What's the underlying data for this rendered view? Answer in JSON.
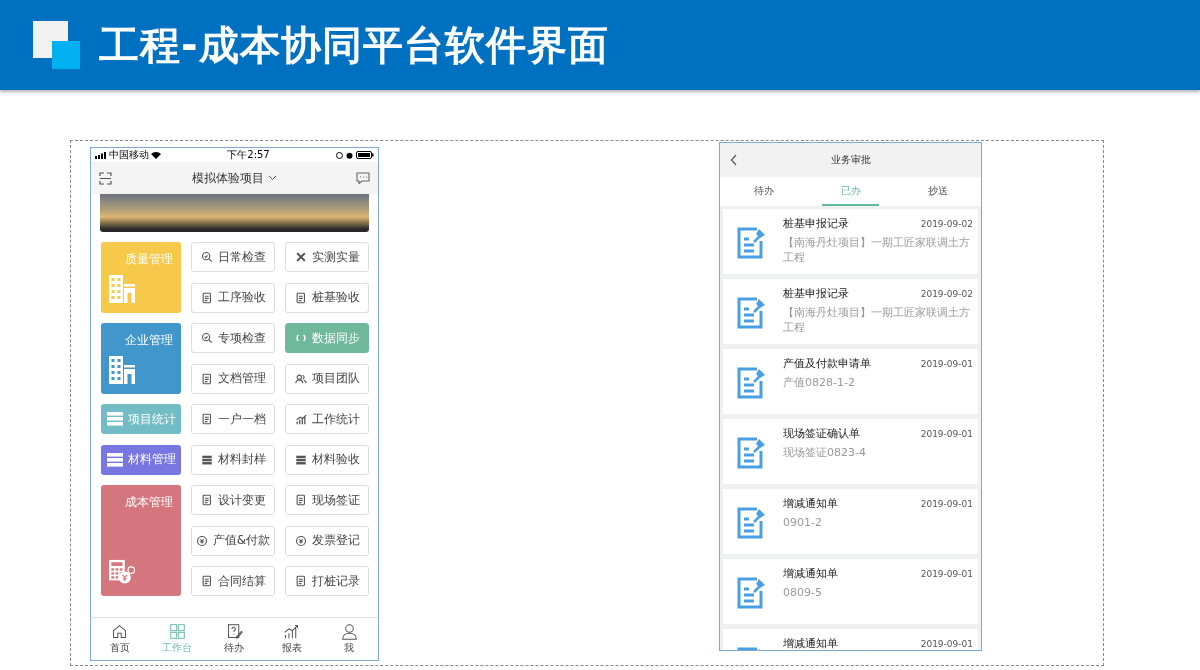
{
  "header": {
    "title": "工程-成本协同平台软件界面"
  },
  "phone_left": {
    "status_bar": {
      "carrier": "中国移动",
      "time": "下午2:57"
    },
    "nav": {
      "title": "模拟体验项目"
    },
    "groups": [
      {
        "label": "质量管理",
        "color": "#f6c94a",
        "kind": "building",
        "actions": [
          {
            "label": "日常检查",
            "active": false
          },
          {
            "label": "实测实量",
            "active": false
          },
          {
            "label": "工序验收",
            "active": false
          },
          {
            "label": "桩基验收",
            "active": false
          }
        ]
      },
      {
        "label": "企业管理",
        "color": "#4196cb",
        "kind": "building",
        "actions": [
          {
            "label": "专项检查",
            "active": false
          },
          {
            "label": "数据同步",
            "active": true
          },
          {
            "label": "文档管理",
            "active": false
          },
          {
            "label": "项目团队",
            "active": false
          }
        ]
      },
      {
        "label": "项目统计",
        "color": "#72bcc6",
        "kind": "list",
        "actions": [
          {
            "label": "一户一档",
            "active": false
          },
          {
            "label": "工作统计",
            "active": false
          }
        ]
      },
      {
        "label": "材料管理",
        "color": "#7877e2",
        "kind": "list",
        "actions": [
          {
            "label": "材料封样",
            "active": false
          },
          {
            "label": "材料验收",
            "active": false
          }
        ]
      },
      {
        "label": "成本管理",
        "color": "#d5767f",
        "kind": "calculator",
        "actions": [
          {
            "label": "设计变更",
            "active": false
          },
          {
            "label": "现场签证",
            "active": false
          },
          {
            "label": "产值&付款",
            "active": false
          },
          {
            "label": "发票登记",
            "active": false
          },
          {
            "label": "合同结算",
            "active": false
          },
          {
            "label": "打桩记录",
            "active": false
          }
        ]
      }
    ],
    "tab_bar": [
      {
        "label": "首页",
        "selected": false
      },
      {
        "label": "工作台",
        "selected": true
      },
      {
        "label": "待办",
        "selected": false
      },
      {
        "label": "报表",
        "selected": false
      },
      {
        "label": "我",
        "selected": false
      }
    ]
  },
  "phone_right": {
    "nav": {
      "title": "业务审批"
    },
    "tabs": [
      {
        "label": "待办",
        "selected": false
      },
      {
        "label": "已办",
        "selected": true
      },
      {
        "label": "抄送",
        "selected": false
      }
    ],
    "records": [
      {
        "title": "桩基申报记录",
        "date": "2019-09-02",
        "subtitle": "【南海丹灶项目】一期工匠家联调土方工程"
      },
      {
        "title": "桩基申报记录",
        "date": "2019-09-02",
        "subtitle": "【南海丹灶项目】一期工匠家联调土方工程"
      },
      {
        "title": "产值及付款申请单",
        "date": "2019-09-01",
        "subtitle": "产值0828-1-2"
      },
      {
        "title": "现场签证确认单",
        "date": "2019-09-01",
        "subtitle": "现场签证0823-4"
      },
      {
        "title": "增减通知单",
        "date": "2019-09-01",
        "subtitle": "0901-2"
      },
      {
        "title": "增减通知单",
        "date": "2019-09-01",
        "subtitle": "0809-5"
      },
      {
        "title": "增减通知单",
        "date": "2019-09-01"
      }
    ]
  }
}
